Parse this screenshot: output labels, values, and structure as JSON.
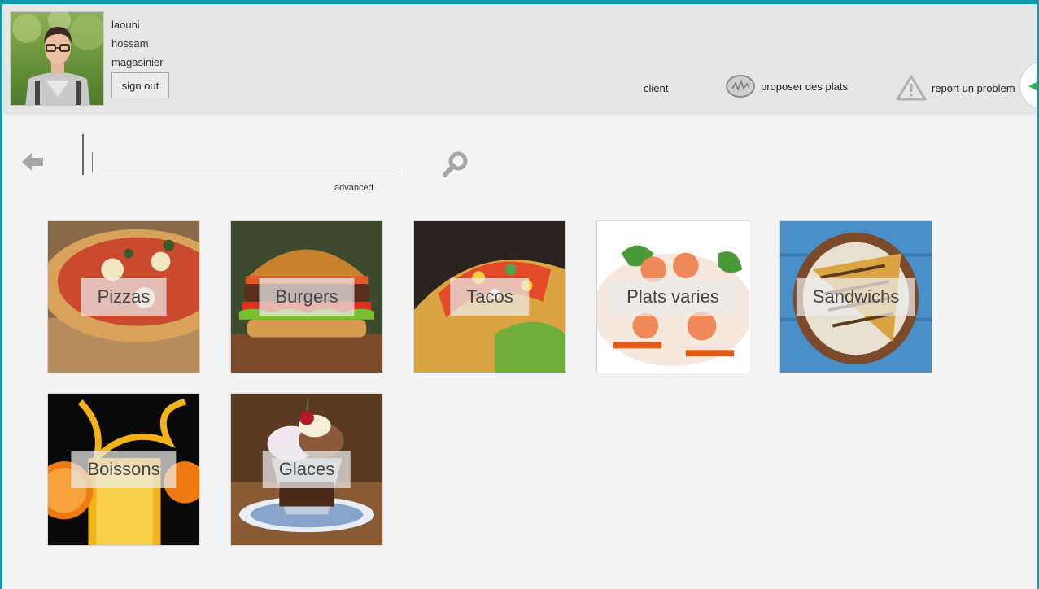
{
  "user": {
    "first_name": "laouni",
    "last_name": "hossam",
    "role": "magasinier",
    "sign_out_label": "sign out"
  },
  "nav": {
    "client_label": "client",
    "propose_label": "proposer des plats",
    "report_label": "report un problem"
  },
  "search": {
    "value": "",
    "advanced_label": "advanced"
  },
  "categories": [
    {
      "label": "Pizzas",
      "icon": "pizza-image"
    },
    {
      "label": "Burgers",
      "icon": "burger-image"
    },
    {
      "label": "Tacos",
      "icon": "tacos-image"
    },
    {
      "label": "Plats varies",
      "icon": "plats-varies-image"
    },
    {
      "label": "Sandwichs",
      "icon": "sandwich-image"
    },
    {
      "label": "Boissons",
      "icon": "drink-image"
    },
    {
      "label": "Glaces",
      "icon": "ice-cream-image"
    }
  ],
  "colors": {
    "frame": "#0e9aa7",
    "header_bg": "#e6e6e6",
    "content_bg": "#f3f3f3",
    "accent_green": "#2db34a"
  }
}
